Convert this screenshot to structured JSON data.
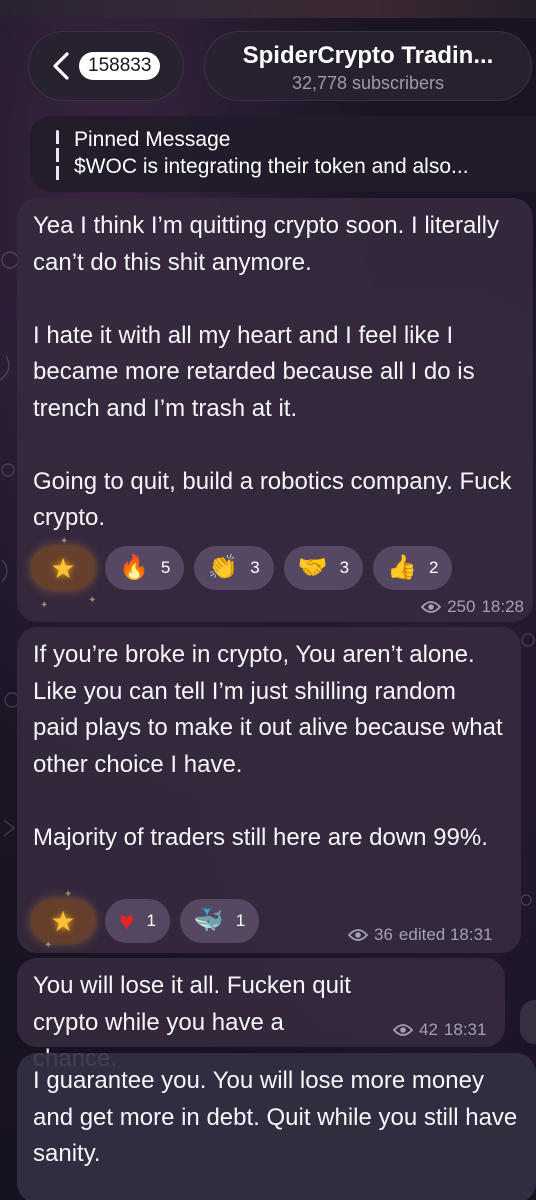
{
  "header": {
    "unread_count": "158833",
    "channel_title": "SpiderCrypto Tradin...",
    "subscribers": "32,778 subscribers"
  },
  "pinned": {
    "title": "Pinned Message",
    "text": "$WOC is integrating their token and also..."
  },
  "messages": [
    {
      "text": "Yea I think I’m quitting crypto soon. I literally can’t do this shit anymore.\n\nI hate it with all my heart and I feel like I became more retarded because all I do is trench and I’m trash at it.\n\nGoing to quit, build a robotics company. Fuck crypto.",
      "reactions": [
        {
          "icon": "star-icon",
          "emoji": "★",
          "count": ""
        },
        {
          "icon": "fire-icon",
          "emoji": "🔥",
          "count": "5"
        },
        {
          "icon": "clap-icon",
          "emoji": "👏",
          "count": "3"
        },
        {
          "icon": "handshake-icon",
          "emoji": "🤝",
          "count": "3"
        },
        {
          "icon": "thumbs-up-icon",
          "emoji": "👍",
          "count": "2"
        }
      ],
      "views": "250",
      "time": "18:28"
    },
    {
      "text": "If you’re broke in crypto, You aren’t alone. Like you can tell I’m just shilling random paid plays to make it out alive because what other choice I have.\n\nMajority of traders still here are down 99%.",
      "reactions": [
        {
          "icon": "star-icon",
          "emoji": "★",
          "count": ""
        },
        {
          "icon": "heart-icon",
          "emoji": "♥",
          "count": "1"
        },
        {
          "icon": "whale-icon",
          "emoji": "🐳",
          "count": "1"
        }
      ],
      "views": "36",
      "time": "edited 18:31"
    },
    {
      "text": "You will lose it all. Fucken quit crypto while you have a chance.",
      "views": "42",
      "time": "18:31"
    },
    {
      "text": "I guarantee you. You will lose more money and get more in debt. Quit while you still have sanity."
    }
  ]
}
